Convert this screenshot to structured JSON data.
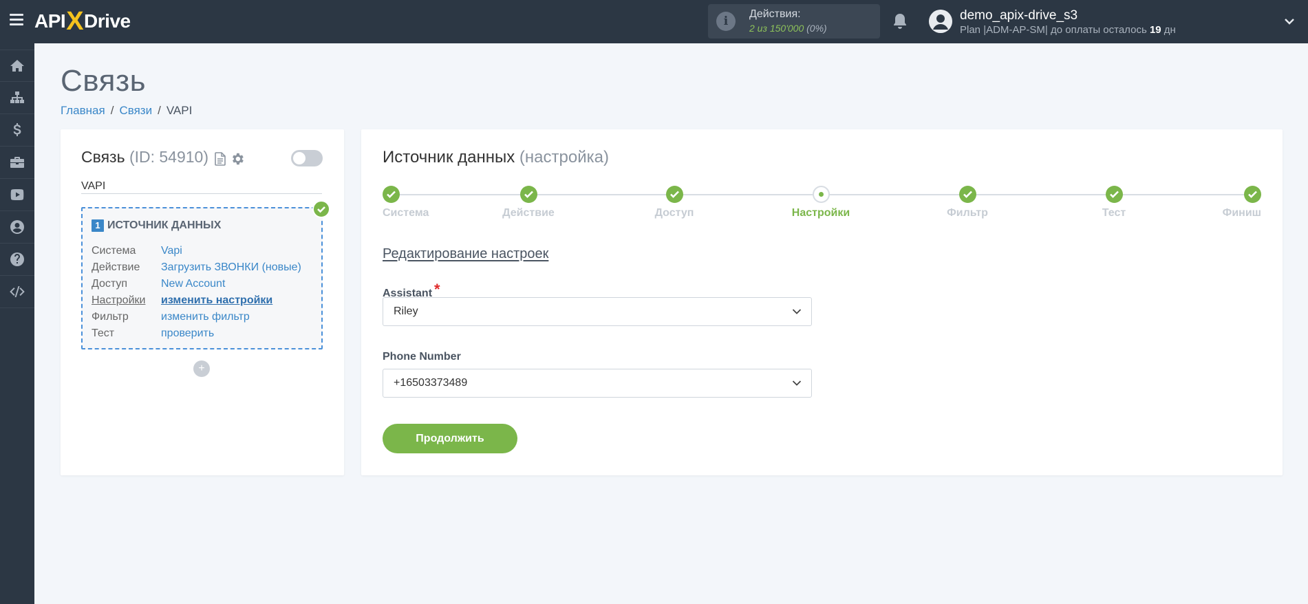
{
  "header": {
    "logo_left": "API",
    "logo_x": "X",
    "logo_right": "Drive",
    "actions_label": "Действия:",
    "actions_value": "2 из 150'000",
    "actions_percent": "(0%)",
    "user_name": "demo_apix-drive_s3",
    "user_plan_prefix": "Plan |ADM-AP-SM| до оплаты осталось",
    "user_plan_days": "19",
    "user_plan_suffix": "дн"
  },
  "sidebar": {
    "items": [
      {
        "icon": "home-icon"
      },
      {
        "icon": "sitemap-icon"
      },
      {
        "icon": "dollar-icon"
      },
      {
        "icon": "briefcase-icon"
      },
      {
        "icon": "youtube-icon"
      },
      {
        "icon": "user-circle-icon"
      },
      {
        "icon": "question-icon"
      },
      {
        "icon": "code-icon"
      }
    ]
  },
  "page": {
    "title": "Связь",
    "breadcrumb": [
      "Главная",
      "Связи",
      "VAPI"
    ]
  },
  "connection": {
    "title": "Связь",
    "id_text": "(ID: 54910)",
    "name": "VAPI",
    "enabled": false,
    "source": {
      "number": "1",
      "heading": "ИСТОЧНИК ДАННЫХ",
      "rows": [
        {
          "key": "Система",
          "value": "Vapi"
        },
        {
          "key": "Действие",
          "value": "Загрузить ЗВОНКИ (новые)"
        },
        {
          "key": "Доступ",
          "value": "New Account"
        },
        {
          "key": "Настройки",
          "value": "изменить настройки"
        },
        {
          "key": "Фильтр",
          "value": "изменить фильтр"
        },
        {
          "key": "Тест",
          "value": "проверить"
        }
      ]
    },
    "add_label": "+"
  },
  "settings": {
    "title": "Источник данных",
    "subtitle": "(настройка)",
    "steps": [
      "Система",
      "Действие",
      "Доступ",
      "Настройки",
      "Фильтр",
      "Тест",
      "Финиш"
    ],
    "current_step": 3,
    "section_title": "Редактирование настроек",
    "assistant_label": "Assistant",
    "assistant_required": "*",
    "assistant_value": "Riley",
    "phone_label": "Phone Number",
    "phone_value": "+16503373489",
    "continue_label": "Продолжить"
  },
  "colors": {
    "topbar": "#2c3744",
    "accent_green": "#7bb64a",
    "link_blue": "#3a87c8",
    "logo_yellow": "#f5c31e"
  }
}
